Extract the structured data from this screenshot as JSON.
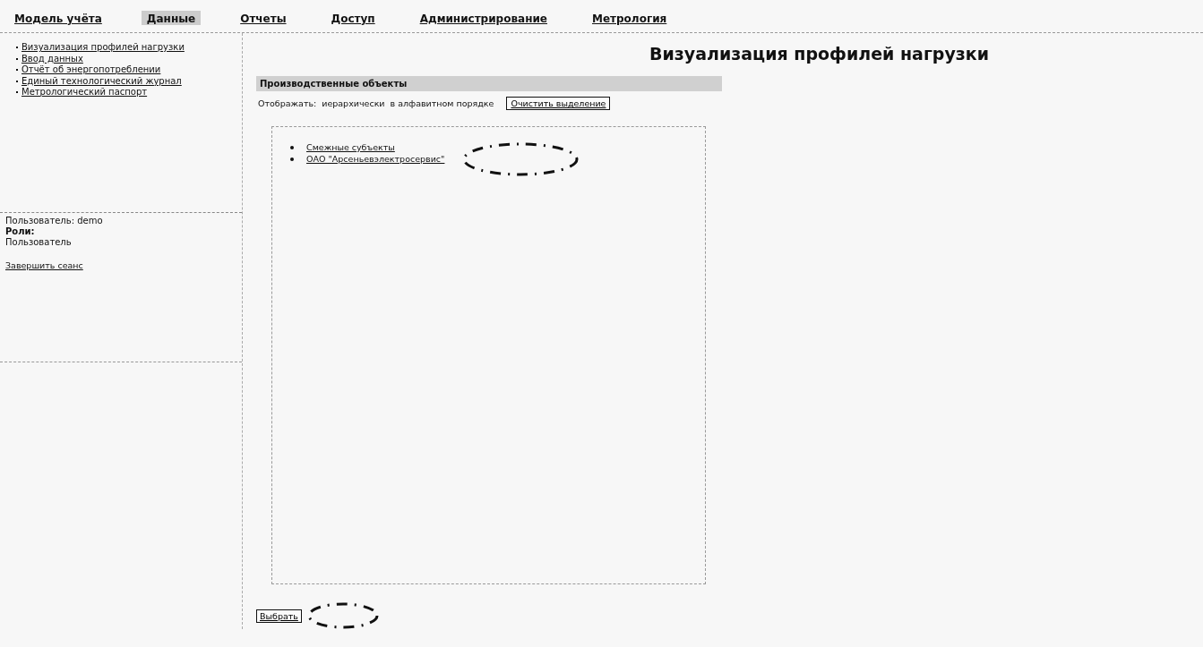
{
  "nav": {
    "items": [
      {
        "label": "Модель учёта",
        "selected": false
      },
      {
        "label": "Данные",
        "selected": true
      },
      {
        "label": "Отчеты",
        "selected": false
      },
      {
        "label": "Доступ",
        "selected": false
      },
      {
        "label": "Администрирование",
        "selected": false
      },
      {
        "label": "Метрология",
        "selected": false
      }
    ]
  },
  "sidebar": {
    "items": [
      "Визуализация профилей нагрузки",
      "Ввод данных",
      "Отчёт об энергопотреблении",
      "Единый технологический журнал",
      "Метрологический паспорт"
    ],
    "user_label": "Пользователь: demo",
    "roles_label": "Роли:",
    "role": "Пользователь",
    "logout": "Завершить сеанс"
  },
  "page_title": "Визуализация профилей нагрузки",
  "panel": {
    "title": "Производственные объекты",
    "display_label": "Отображать:",
    "display_options": [
      "иерархически",
      "в алфавитном порядке"
    ],
    "clear_button": "Очистить выделение",
    "tree": [
      {
        "label": "Смежные субъекты",
        "marked": false
      },
      {
        "label": "ОАО \"Арсеньевэлектросервис\"",
        "marked": true
      }
    ],
    "select_button": "Выбрать",
    "select_marked": true
  }
}
